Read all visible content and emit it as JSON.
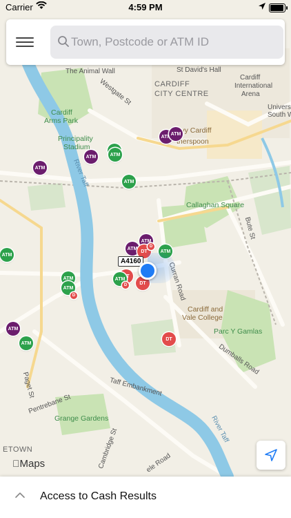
{
  "status_bar": {
    "carrier": "Carrier",
    "time": "4:59 PM"
  },
  "search": {
    "placeholder": "Town, Postcode or ATM ID"
  },
  "map": {
    "labels": {
      "animal_wall": "The Animal Wall",
      "st_davids_hall": "St David's Hall",
      "cardiff": "CARDIFF",
      "city_centre": "CITY CENTRE",
      "cardiff_international": "Cardiff",
      "international": "International",
      "arena": "Arena",
      "univers": "Univers",
      "south_w": "South W",
      "cardiff_arms": "Cardiff",
      "arms_park": "Arms Park",
      "westgate_st": "Westgate St",
      "principality": "Principality",
      "stadium": "Stadium",
      "lvy_cardiff": "lvy Cardiff",
      "therspoon": "therspoon",
      "river_taff": "River Taff",
      "callaghan_square": "Callaghan Square",
      "bute_st": "Bute St",
      "curran_road": "Curran Road",
      "cardiff_vale_1": "Cardiff and",
      "cardiff_vale_2": "Vale College",
      "parc_y_gamlas": "Parc Y Gamlas",
      "dumballs_road": "Dumballs Road",
      "taff_embankment": "Taff Embankment",
      "paget_st": "Paget St",
      "pentrebane_st": "Pentrebane St",
      "grange_gardens": "Grange Gardens",
      "river_taff_2": "River Taff",
      "cambridge_st": "Cambridge St",
      "etown": "ETOWN",
      "ele_road": "ele Road",
      "road_shield": "A4160"
    },
    "pin_atm": "ATM",
    "pin_dt": "DT",
    "pin_d": "D",
    "attribution": "Maps"
  },
  "bottom_sheet": {
    "title": "Access to Cash Results"
  },
  "colors": {
    "atm_green": "#2ca14b",
    "atm_purple": "#6b1d6d",
    "drive_through": "#e24b4b",
    "user_location": "#1f7cf5",
    "river": "#8ec9e6",
    "park": "#c9e3b4"
  },
  "icons": {
    "menu": "hamburger-icon",
    "search": "search-icon",
    "locate": "location-arrow-icon",
    "chevron": "chevron-up-icon",
    "wifi": "wifi-icon",
    "battery": "battery-icon"
  }
}
